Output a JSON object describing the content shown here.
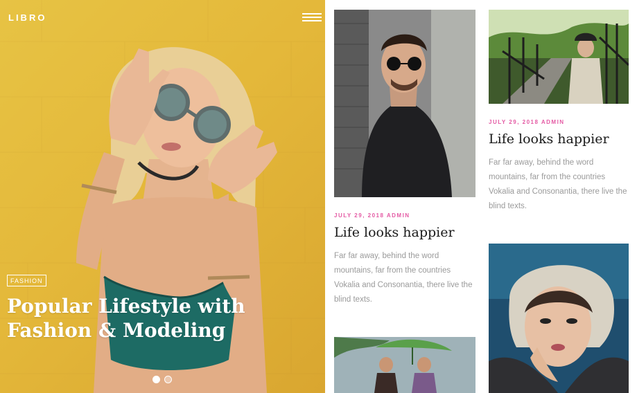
{
  "brand": "LIBRO",
  "hero": {
    "tag": "FASHION",
    "title": "Popular Lifestyle with Fashion & Modeling",
    "slides_count": 2,
    "active_slide": 1
  },
  "posts": [
    {
      "meta": "JULY 29, 2018  ADMIN",
      "title": "Life looks happier",
      "excerpt": "Far far away, behind the word mountains, far from the countries Vokalia and Consonantia, there live the blind texts."
    },
    {
      "meta": "JULY 29, 2018  ADMIN",
      "title": "Life looks happier",
      "excerpt": "Far far away, behind the word mountains, far from the countries Vokalia and Consonantia, there live the blind texts."
    }
  ],
  "colors": {
    "accent": "#e45aa4",
    "hero_bg": "#e4b83a",
    "excerpt": "#9a9a9a"
  },
  "icons": {
    "menu": "hamburger-icon"
  }
}
